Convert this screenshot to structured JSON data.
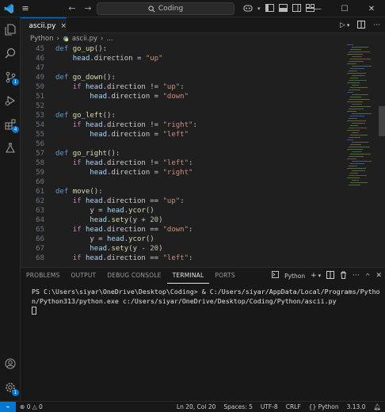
{
  "titlebar": {
    "logo": "VS Code",
    "search_text": "Coding",
    "nav_back": "←",
    "nav_forward": "→"
  },
  "activity": {
    "source_control_badge": "1",
    "extensions_badge": "4",
    "settings_badge": "1"
  },
  "tab": {
    "label": "ascii.py",
    "close": "×"
  },
  "breadcrumb": {
    "items": [
      "Python",
      "ascii.py",
      "..."
    ]
  },
  "editor": {
    "lines": [
      {
        "n": "45",
        "t": "def go_up():"
      },
      {
        "n": "46",
        "t": "    head.direction = \"up\""
      },
      {
        "n": "47",
        "t": ""
      },
      {
        "n": "49",
        "t": "def go_down():"
      },
      {
        "n": "50",
        "t": "    if head.direction != \"up\":"
      },
      {
        "n": "51",
        "t": "        head.direction = \"down\""
      },
      {
        "n": "52",
        "t": ""
      },
      {
        "n": "53",
        "t": "def go_left():"
      },
      {
        "n": "54",
        "t": "    if head.direction != \"right\":"
      },
      {
        "n": "55",
        "t": "        head.direction = \"left\""
      },
      {
        "n": "56",
        "t": ""
      },
      {
        "n": "57",
        "t": "def go_right():"
      },
      {
        "n": "58",
        "t": "    if head.direction != \"left\":"
      },
      {
        "n": "59",
        "t": "        head.direction = \"right\""
      },
      {
        "n": "60",
        "t": ""
      },
      {
        "n": "61",
        "t": "def move():"
      },
      {
        "n": "62",
        "t": "    if head.direction == \"up\":"
      },
      {
        "n": "63",
        "t": "        y = head.ycor()"
      },
      {
        "n": "64",
        "t": "        head.sety(y + 20)"
      },
      {
        "n": "65",
        "t": "    if head.direction == \"down\":"
      },
      {
        "n": "66",
        "t": "        y = head.ycor()"
      },
      {
        "n": "67",
        "t": "        head.sety(y - 20)"
      },
      {
        "n": "68",
        "t": "    if head.direction == \"left\":"
      }
    ]
  },
  "panel": {
    "tabs": [
      "PROBLEMS",
      "OUTPUT",
      "DEBUG CONSOLE",
      "TERMINAL",
      "PORTS"
    ],
    "active_tab": "TERMINAL",
    "shell_label": "Python",
    "terminal_line": "PS C:\\Users\\siyar\\OneDrive\\Desktop\\Coding> & C:/Users/siyar/AppData/Local/Programs/Python/Python313/python.exe c:/Users/siyar/OneDrive/Desktop/Coding/Python/ascii.py"
  },
  "statusbar": {
    "errors": "0",
    "warnings": "0",
    "position": "Ln 20, Col 20",
    "spaces": "Spaces: 5",
    "encoding": "UTF-8",
    "eol": "CRLF",
    "language": "Python",
    "version": "3.13.0"
  }
}
